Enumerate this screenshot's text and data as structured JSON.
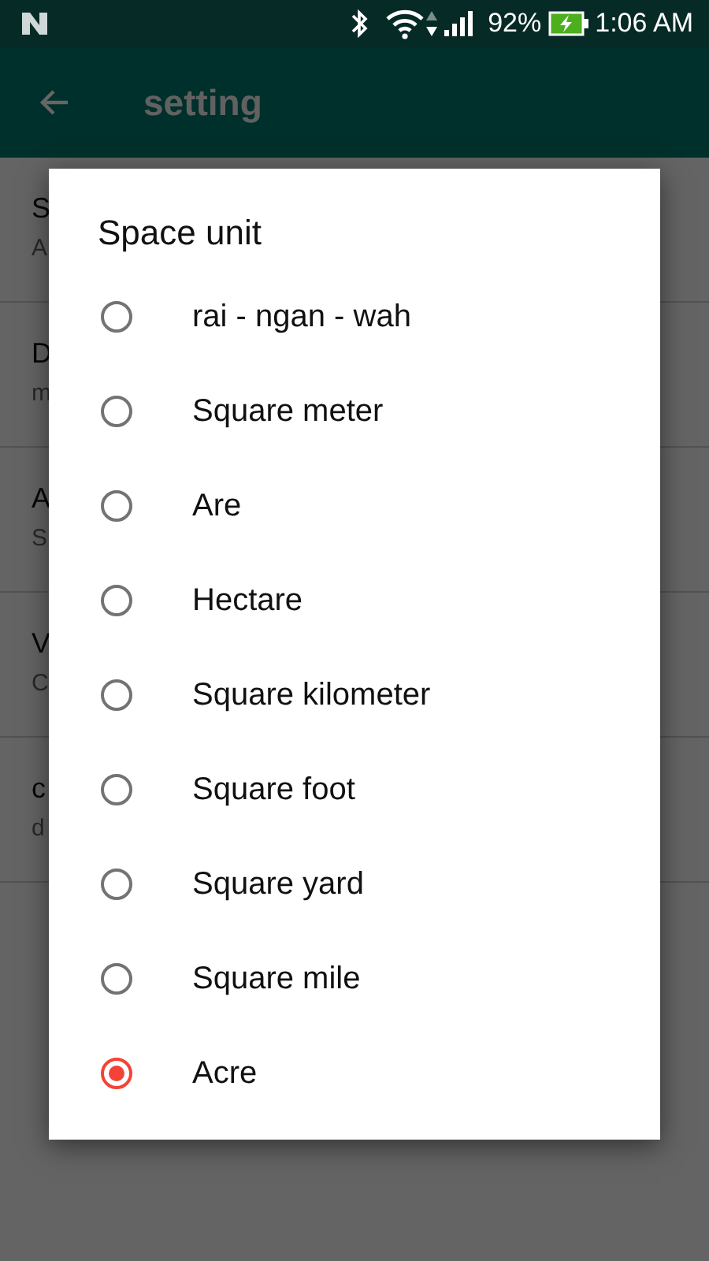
{
  "status_bar": {
    "battery": "92%",
    "time": "1:06 AM",
    "charging": true
  },
  "app_bar": {
    "title": "setting"
  },
  "settings_items": [
    {
      "title": "S",
      "subtitle": "A"
    },
    {
      "title": "D",
      "subtitle": "m"
    },
    {
      "title": "A",
      "subtitle": "S"
    },
    {
      "title": "V",
      "subtitle": "C"
    },
    {
      "title": "c",
      "subtitle": "d"
    }
  ],
  "dialog": {
    "title": "Space unit",
    "options": [
      {
        "label": "rai - ngan - wah",
        "selected": false
      },
      {
        "label": "Square meter",
        "selected": false
      },
      {
        "label": "Are",
        "selected": false
      },
      {
        "label": "Hectare",
        "selected": false
      },
      {
        "label": "Square kilometer",
        "selected": false
      },
      {
        "label": "Square foot",
        "selected": false
      },
      {
        "label": "Square yard",
        "selected": false
      },
      {
        "label": "Square mile",
        "selected": false
      },
      {
        "label": "Acre",
        "selected": true
      }
    ]
  }
}
